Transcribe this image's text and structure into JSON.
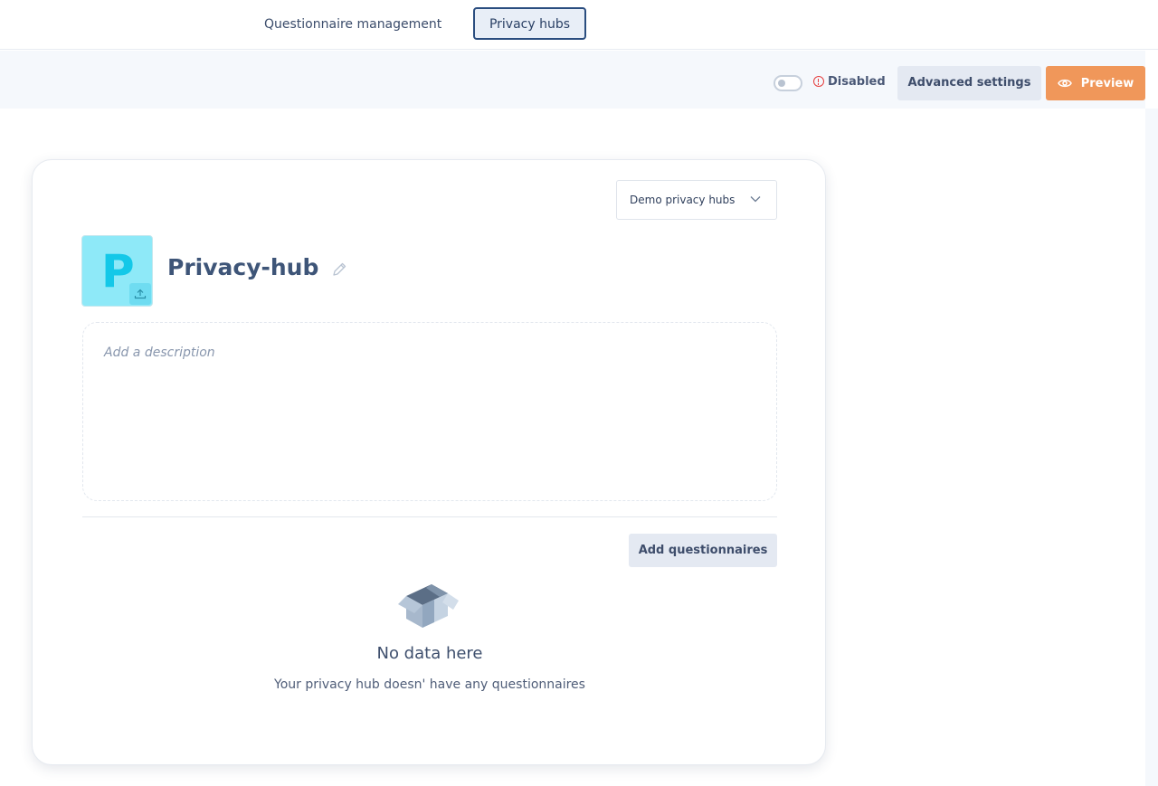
{
  "nav": {
    "tabs": [
      {
        "label": "Questionnaire management",
        "active": false
      },
      {
        "label": "Privacy hubs",
        "active": true
      }
    ]
  },
  "toolbar": {
    "toggle_on": false,
    "status_label": "Disabled",
    "advanced_label": "Advanced settings",
    "preview_label": "Preview"
  },
  "hub": {
    "selector_value": "Demo privacy hubs",
    "logo_letter": "P",
    "title": "Privacy-hub",
    "description_placeholder": "Add a description",
    "add_questionnaires_label": "Add questionnaires",
    "empty_title": "No data here",
    "empty_subtitle": "Your privacy hub doesn' have any questionnaires"
  },
  "colors": {
    "accent": "#f0975a",
    "active_tab_border": "#2a4d7f",
    "logo_bg": "#8ee9f8",
    "logo_letter": "#14c8e8",
    "warning": "#e53e3e"
  },
  "icons": [
    "warning-icon",
    "eye-icon",
    "chevron-down-icon",
    "upload-icon",
    "pencil-icon",
    "empty-box-icon"
  ]
}
